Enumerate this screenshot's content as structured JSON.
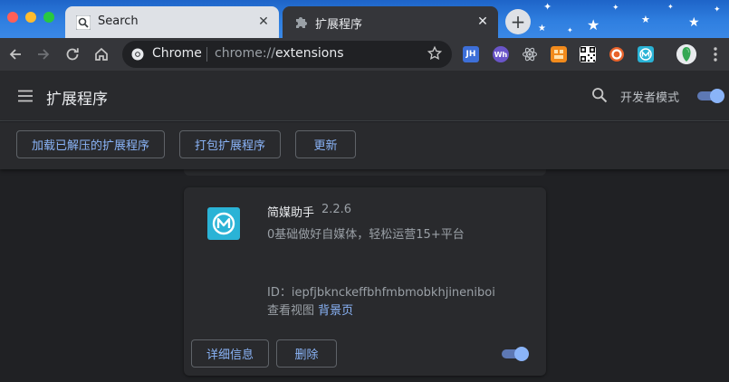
{
  "colors": {
    "accent": "#8ab4f8",
    "toggle_track": "#5d78b4",
    "background": "#202124",
    "surface": "#292a2d",
    "toolbar": "#35363a",
    "tab_strip": "#2f7fe0"
  },
  "tabs": [
    {
      "title": "Search",
      "icon": "magnifier-icon",
      "active": false
    },
    {
      "title": "扩展程序",
      "icon": "puzzle-piece-icon",
      "active": true
    }
  ],
  "tab_close_label": "✕",
  "new_tab_label": "+",
  "omnibox": {
    "site_label": "Chrome",
    "url_scheme": "chrome://",
    "url_host": "extensions"
  },
  "toolbar_extensions": [
    {
      "icon": "jh-icon",
      "label": "JH",
      "color": "#3d6fd8"
    },
    {
      "icon": "wh-icon",
      "label": "Wh",
      "color": "#6a55c9"
    },
    {
      "icon": "react-icon",
      "label": "",
      "color": "#35363a"
    },
    {
      "icon": "orange-grid-icon",
      "label": "",
      "color": "#f28b1c"
    },
    {
      "icon": "qr-code-icon",
      "label": "",
      "color": "#ffffff"
    },
    {
      "icon": "lifebuoy-icon",
      "label": "",
      "color": "#e8622a"
    },
    {
      "icon": "jianmei-icon",
      "label": "",
      "color": "#2ab3d6"
    }
  ],
  "header": {
    "title": "扩展程序",
    "developer_mode_label": "开发者模式",
    "developer_mode_on": true
  },
  "actions": {
    "load_unpacked": "加载已解压的扩展程序",
    "pack": "打包扩展程序",
    "update": "更新"
  },
  "extension": {
    "name": "简媒助手",
    "version": "2.2.6",
    "description": "0基础做好自媒体，轻松运营15+平台",
    "id_text": "ID：iepfjbknckeffbhfmbmobkhjineniboi",
    "views_prefix": "查看视图",
    "views_link": "背景页",
    "details_button": "详细信息",
    "remove_button": "删除",
    "enabled": true
  }
}
